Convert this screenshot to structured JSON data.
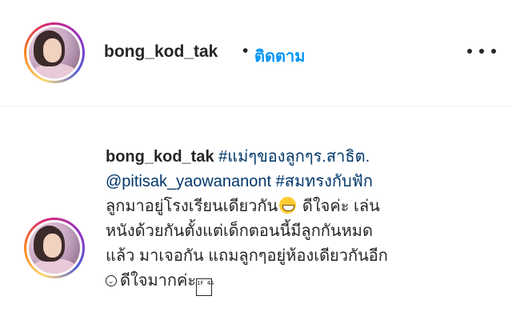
{
  "post_header": {
    "username": "bong_kod_tak",
    "separator": "•",
    "follow_label": "ติดตาม",
    "more_icon": "more-horizontal-icon"
  },
  "caption": {
    "username": "bong_kod_tak",
    "line1_hashtag": "#แม่ๆของลูกๆร.สาธิต.",
    "line2_mention": "@pitisak_yaowananont",
    "line2_hashtag": "#สมทรงกับฟัก",
    "line3_text": "ลูกมาอยู่โรงเรียนเดียวกัน",
    "line3_emoji": "grinning-face-emoji",
    "line3_text_after": " ดีใจค่ะ เล่น",
    "line4_text": "หนังด้วยกันตั้งแต่เด็กตอนนี้มีลูกกันหมด",
    "line5_text": "แล้ว มาเจอกัน แถมลูกๆอยู่ห้องเดียวกันอีก",
    "line6_emoji": "smiling-face-emoji",
    "line6_text": "ดีใจมากค่ะ",
    "line6_glyph": "1F 4A"
  },
  "colors": {
    "text": "#262626",
    "follow_blue": "#0095f6",
    "link_dark_blue": "#00376b",
    "divider": "#efefef"
  }
}
